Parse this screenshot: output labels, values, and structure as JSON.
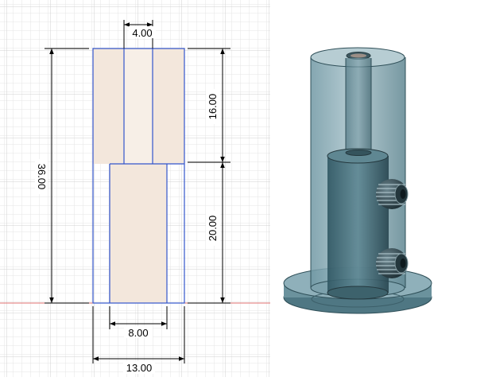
{
  "sketch": {
    "dimensions": {
      "shaft_diameter": "4.00",
      "upper_height": "16.00",
      "total_height": "36.00",
      "lower_height": "20.00",
      "bore_diameter": "8.00",
      "outer_diameter": "13.00"
    }
  },
  "colors": {
    "grid_minor": "#e6e6e6",
    "grid_major": "#cfcfcf",
    "profile_fill": "#f3e7dc",
    "profile_line": "#3355cc",
    "dimension_line": "#000000",
    "axis_line": "#e07070",
    "body_translucent": "#5f8a96",
    "body_edge": "#2f4f58"
  },
  "model_view": {
    "icons": [
      "cylinder-body",
      "set-screw",
      "base-flange"
    ]
  }
}
